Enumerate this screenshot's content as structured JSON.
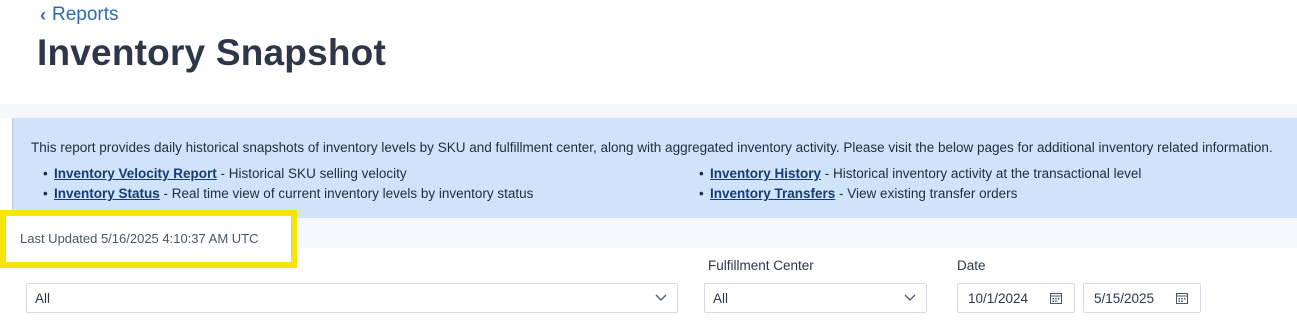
{
  "nav": {
    "back_label": "Reports"
  },
  "page": {
    "title": "Inventory Snapshot"
  },
  "info": {
    "description": "This report provides daily historical snapshots of inventory levels by SKU and fulfillment center, along with aggregated inventory activity. Please visit the below pages for additional inventory related information.",
    "links_left": [
      {
        "label": "Inventory Velocity Report",
        "desc": " - Historical SKU selling velocity"
      },
      {
        "label": "Inventory Status",
        "desc": " - Real time view of current inventory levels by inventory status"
      }
    ],
    "links_right": [
      {
        "label": "Inventory History",
        "desc": " - Historical inventory activity at the transactional level"
      },
      {
        "label": "Inventory Transfers",
        "desc": " - View existing transfer orders"
      }
    ]
  },
  "status": {
    "last_updated": "Last Updated 5/16/2025 4:10:37 AM UTC"
  },
  "filters": {
    "first_value": "All",
    "fulfillment_center_label": "Fulfillment Center",
    "fulfillment_center_value": "All",
    "date_label": "Date",
    "date_start": "10/1/2024",
    "date_end": "5/15/2025"
  },
  "colors": {
    "highlight": "#f7e40a",
    "info_bg": "#cfe3fb",
    "link": "#2b6cb0"
  }
}
